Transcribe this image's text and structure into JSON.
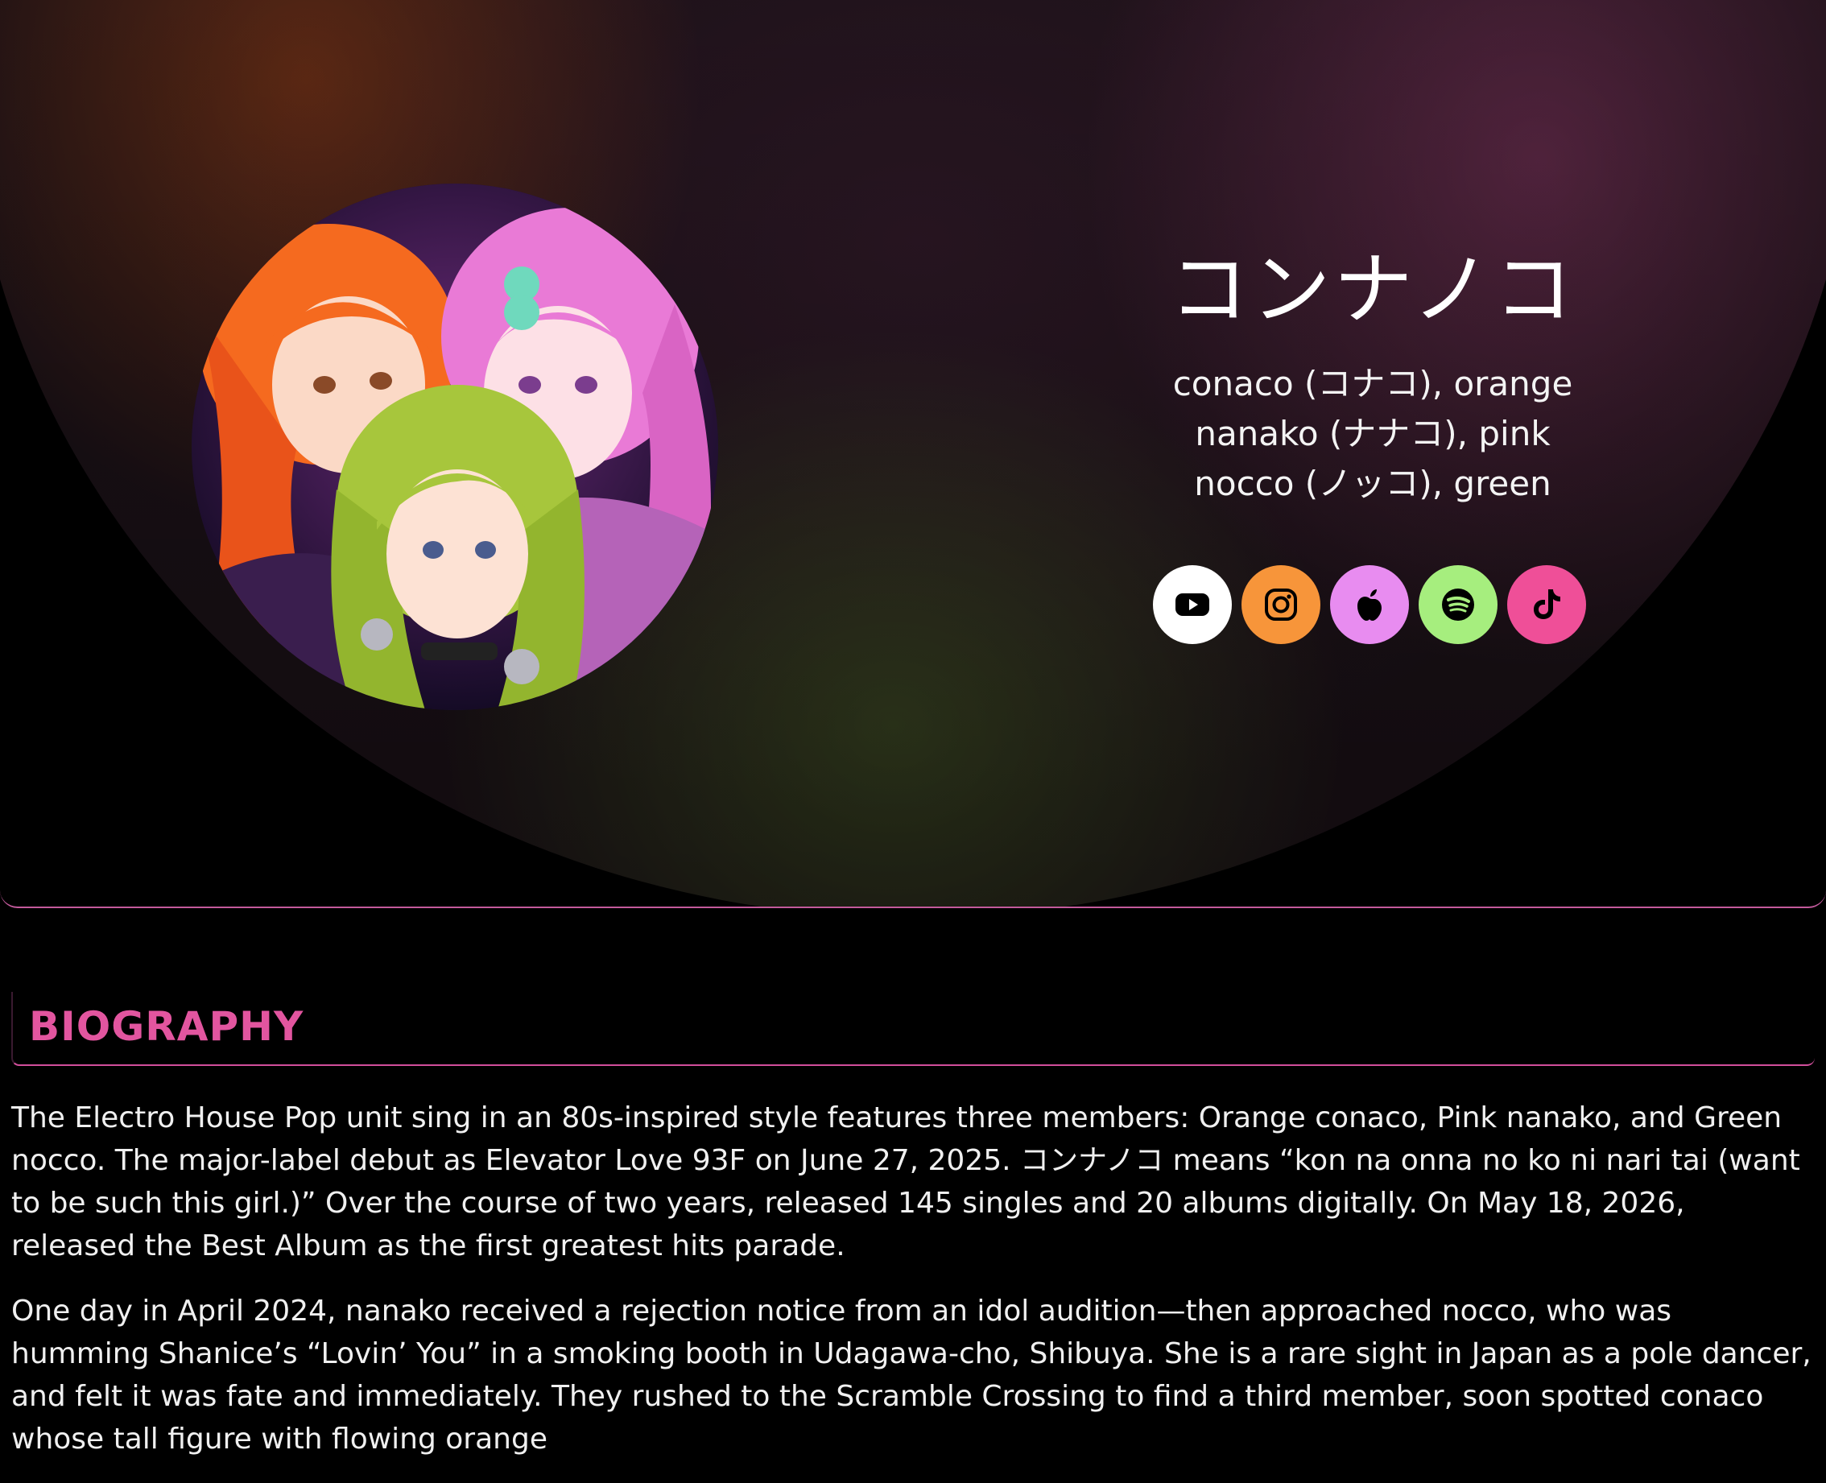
{
  "hero": {
    "group_name": "コンナノコ",
    "members": [
      "conaco (コナコ), orange",
      "nanako (ナナコ), pink",
      "nocco (ノッコ), green"
    ]
  },
  "socials": [
    {
      "name": "youtube-icon",
      "color": "#ffffff"
    },
    {
      "name": "instagram-icon",
      "color": "#f7953a"
    },
    {
      "name": "apple-music-icon",
      "color": "#e88cf0"
    },
    {
      "name": "spotify-icon",
      "color": "#a6ee7e"
    },
    {
      "name": "tiktok-icon",
      "color": "#ef4f98"
    }
  ],
  "biography": {
    "heading": "BIOGRAPHY",
    "paragraphs": [
      "The Electro House Pop unit sing in an 80s-inspired style features three members: Orange conaco, Pink nanako, and Green nocco. The major-label debut as Elevator Love 93F on June 27, 2025. コンナノコ means “kon na onna no ko ni nari tai (want to be such this girl.)” Over the course of two years, released 145 singles and 20 albums digitally. On May 18, 2026, released the Best Album as the first greatest hits parade.",
      "One day in April 2024, nanako received a rejection notice from an idol audition—then approached nocco, who was humming Shanice’s “Lovin’ You” in a smoking booth in Udagawa-cho, Shibuya. She is a rare sight in Japan as a pole dancer, and felt it was fate and immediately. They rushed to the Scramble Crossing to find a third member, soon spotted conaco whose tall figure with flowing orange"
    ]
  },
  "colors": {
    "accent": "#e2559f",
    "border": "#c35a9c",
    "background": "#000000"
  }
}
